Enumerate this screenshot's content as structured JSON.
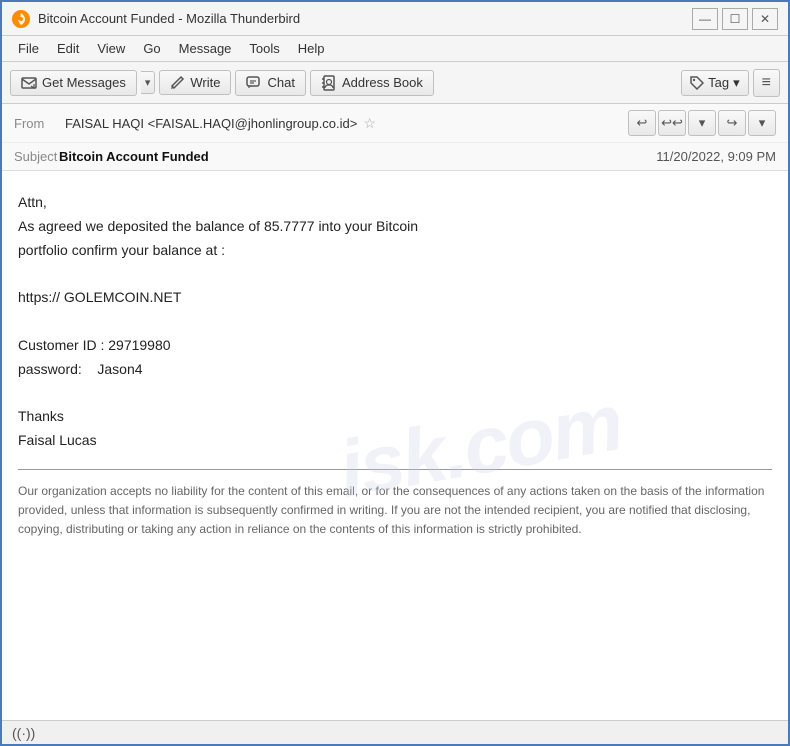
{
  "window": {
    "title": "Bitcoin Account Funded - Mozilla Thunderbird",
    "controls": {
      "minimize": "—",
      "maximize": "☐",
      "close": "✕"
    }
  },
  "menubar": {
    "items": [
      "File",
      "Edit",
      "View",
      "Go",
      "Message",
      "Tools",
      "Help"
    ]
  },
  "toolbar": {
    "get_messages_label": "Get Messages",
    "write_label": "Write",
    "chat_label": "Chat",
    "address_book_label": "Address Book",
    "tag_label": "Tag",
    "dropdown_arrow": "▾",
    "menu_icon": "≡"
  },
  "email": {
    "from_label": "From",
    "from_value": "FAISAL HAQI <FAISAL.HAQI@jhonlingroup.co.id>",
    "subject_label": "Subject",
    "subject_value": "Bitcoin Account Funded",
    "date_value": "11/20/2022, 9:09 PM",
    "body": "Attn,\nAs agreed we deposited the balance of 85.7777 into your Bitcoin\nportfolio confirm your balance at :\n\nhttps:// GOLEMCOIN.NET\n\nCustomer ID : 29719980\npassword:    Jason4\n\nThanks\nFaisal Lucas",
    "disclaimer": "Our organization accepts no liability for the content of this email, or for the consequences of any actions taken on the basis of the information provided, unless that information is subsequently confirmed in writing. If you are not the intended recipient, you are notified that disclosing, copying, distributing or taking any action in reliance on the contents of this information is strictly prohibited."
  },
  "watermark": {
    "line1": "isk.com"
  },
  "nav_buttons": [
    "↩",
    "↩↩",
    "▾",
    "↪",
    "▾"
  ],
  "status_bar": {
    "icon": "((·))"
  }
}
